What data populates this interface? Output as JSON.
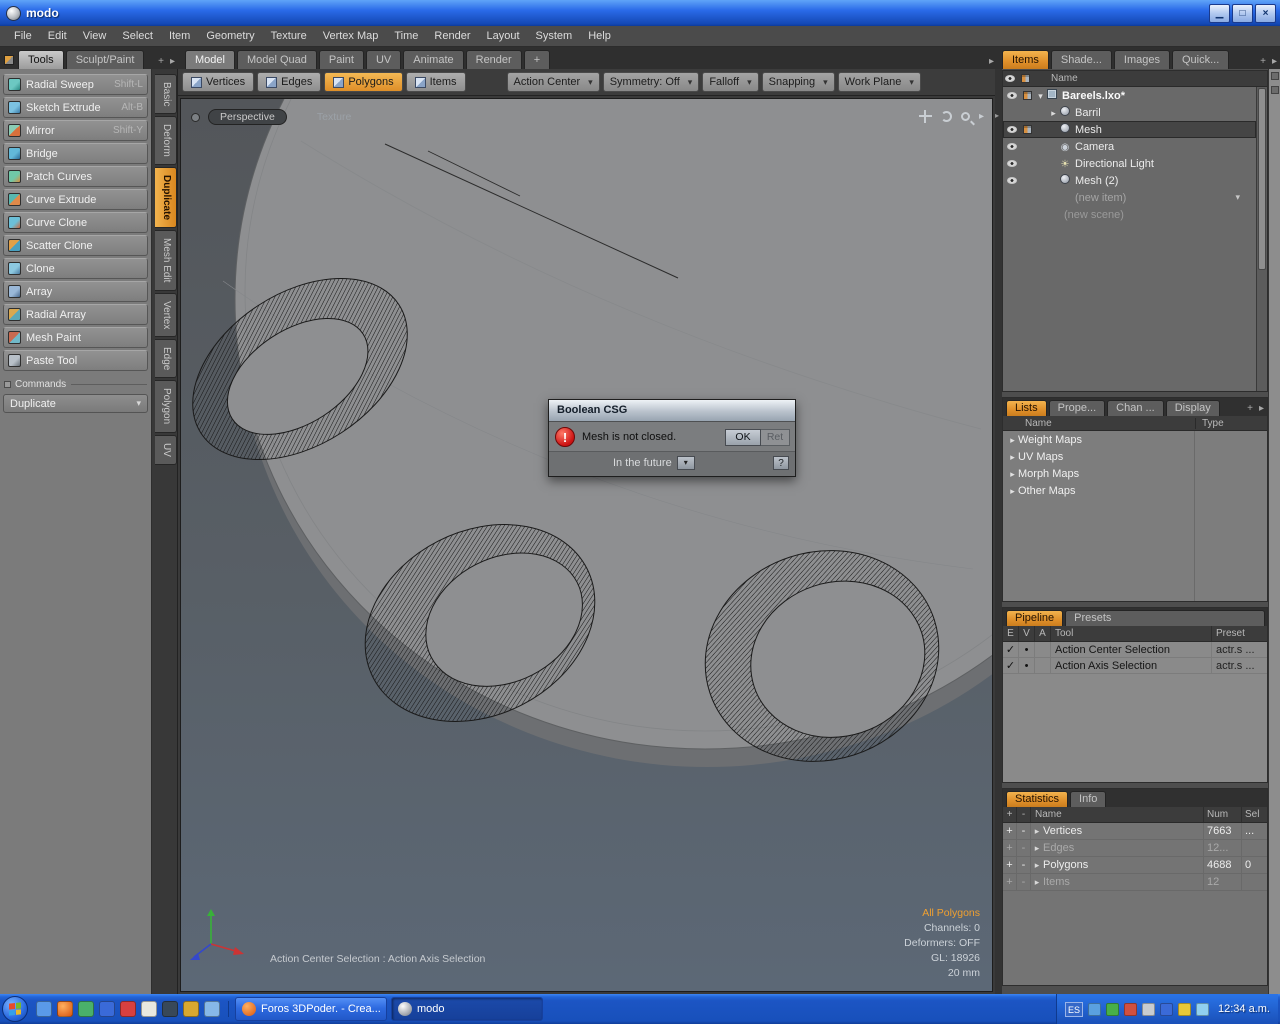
{
  "titlebar": {
    "title": "modo",
    "minimize_glyph": "▁",
    "maximize_glyph": "□",
    "close_glyph": "×"
  },
  "menubar": {
    "items": [
      "File",
      "Edit",
      "View",
      "Select",
      "Item",
      "Geometry",
      "Texture",
      "Vertex Map",
      "Time",
      "Render",
      "Layout",
      "System",
      "Help"
    ]
  },
  "left_tabs": {
    "items": [
      {
        "label": "Tools",
        "active": true
      },
      {
        "label": "Sculpt/Paint",
        "active": false
      }
    ]
  },
  "viewport_tabs": {
    "items": [
      {
        "label": "Model",
        "active": true
      },
      {
        "label": "Model Quad"
      },
      {
        "label": "Paint"
      },
      {
        "label": "UV"
      },
      {
        "label": "Animate"
      },
      {
        "label": "Render"
      },
      {
        "label": "+"
      }
    ]
  },
  "right_tabs": {
    "items": [
      {
        "label": "Items",
        "active": true
      },
      {
        "label": "Shade..."
      },
      {
        "label": "Images"
      },
      {
        "label": "Quick..."
      }
    ]
  },
  "tool_panel": {
    "tools": [
      {
        "label": "Radial Sweep",
        "shortcut": "Shift-L"
      },
      {
        "label": "Sketch Extrude",
        "shortcut": "Alt-B"
      },
      {
        "label": "Mirror",
        "shortcut": "Shift-Y"
      },
      {
        "label": "Bridge",
        "shortcut": ""
      },
      {
        "label": "Patch Curves",
        "shortcut": ""
      },
      {
        "label": "Curve Extrude",
        "shortcut": ""
      },
      {
        "label": "Curve Clone",
        "shortcut": ""
      },
      {
        "label": "Scatter Clone",
        "shortcut": ""
      },
      {
        "label": "Clone",
        "shortcut": ""
      },
      {
        "label": "Array",
        "shortcut": ""
      },
      {
        "label": "Radial Array",
        "shortcut": ""
      },
      {
        "label": "Mesh Paint",
        "shortcut": ""
      },
      {
        "label": "Paste Tool",
        "shortcut": ""
      }
    ],
    "commands_header": "Commands",
    "command_value": "Duplicate"
  },
  "mode_tabs": {
    "items": [
      {
        "label": "Basic"
      },
      {
        "label": "Deform"
      },
      {
        "label": "Duplicate",
        "active": true
      },
      {
        "label": "Mesh Edit"
      },
      {
        "label": "Vertex"
      },
      {
        "label": "Edge"
      },
      {
        "label": "Polygon"
      },
      {
        "label": "UV"
      }
    ]
  },
  "selection_toolbar": {
    "buttons": [
      {
        "label": "Vertices"
      },
      {
        "label": "Edges"
      },
      {
        "label": "Polygons",
        "active": true
      },
      {
        "label": "Items"
      }
    ],
    "dropdowns": [
      {
        "label": "Action Center"
      },
      {
        "label": "Symmetry: Off"
      },
      {
        "label": "Falloff"
      },
      {
        "label": "Snapping"
      },
      {
        "label": "Work Plane"
      }
    ]
  },
  "viewport": {
    "view_mode": "Perspective",
    "shading_mode": "Texture",
    "status": "Action Center Selection : Action Axis Selection",
    "selection_info": "All Polygons",
    "channels": "Channels: 0",
    "deformers": "Deformers: OFF",
    "gl": "GL: 18926",
    "grid_size": "20 mm"
  },
  "dialog": {
    "title": "Boolean CSG",
    "message": "Mesh is not closed.",
    "ok_label": "OK",
    "second_label": "Ret",
    "future_label": "In the future",
    "help_label": "?"
  },
  "items_panel": {
    "name_header": "Name",
    "rows": [
      {
        "label": "Bareels.lxo*"
      },
      {
        "label": "Barril"
      },
      {
        "label": "Mesh"
      },
      {
        "label": "Camera"
      },
      {
        "label": "Directional Light"
      },
      {
        "label": "Mesh (2)"
      },
      {
        "label": "(new item)"
      },
      {
        "label": "(new scene)"
      }
    ]
  },
  "lists_panel": {
    "tabs": [
      {
        "label": "Lists",
        "active": true
      },
      {
        "label": "Prope..."
      },
      {
        "label": "Chan ..."
      },
      {
        "label": "Display"
      }
    ],
    "col_name": "Name",
    "col_type": "Type",
    "rows": [
      {
        "label": "Weight Maps"
      },
      {
        "label": "UV Maps"
      },
      {
        "label": "Morph Maps"
      },
      {
        "label": "Other Maps"
      }
    ]
  },
  "pipeline_panel": {
    "tabs": [
      {
        "label": "Pipeline",
        "active": true
      },
      {
        "label": "Presets"
      }
    ],
    "cols": {
      "e": "E",
      "v": "V",
      "a": "A",
      "tool": "Tool",
      "preset": "Preset"
    },
    "rows": [
      {
        "enabled": "✓",
        "vis": "•",
        "tool": "Action Center Selection",
        "preset": "actr.s ..."
      },
      {
        "enabled": "✓",
        "vis": "•",
        "tool": "Action Axis Selection",
        "preset": "actr.s ..."
      }
    ]
  },
  "stats_panel": {
    "tabs": [
      {
        "label": "Statistics",
        "active": true
      },
      {
        "label": "Info"
      }
    ],
    "cols": {
      "plus": "+",
      "minus": "-",
      "name": "Name",
      "num": "Num",
      "sel": "Sel"
    },
    "rows": [
      {
        "plus": "+",
        "minus": "-",
        "name": "Vertices",
        "num": "7663",
        "sel": "..."
      },
      {
        "plus": "+",
        "minus": "-",
        "name": "Edges",
        "num": "12...",
        "sel": ""
      },
      {
        "plus": "+",
        "minus": "-",
        "name": "Polygons",
        "num": "4688",
        "sel": "0"
      },
      {
        "plus": "+",
        "minus": "-",
        "name": "Items",
        "num": "12",
        "sel": ""
      }
    ]
  },
  "taskbar": {
    "tasks": [
      {
        "label": "Foros 3DPoder. - Crea..."
      },
      {
        "label": "modo",
        "active": true
      }
    ],
    "language": "ES",
    "clock": "12:34 a.m."
  }
}
